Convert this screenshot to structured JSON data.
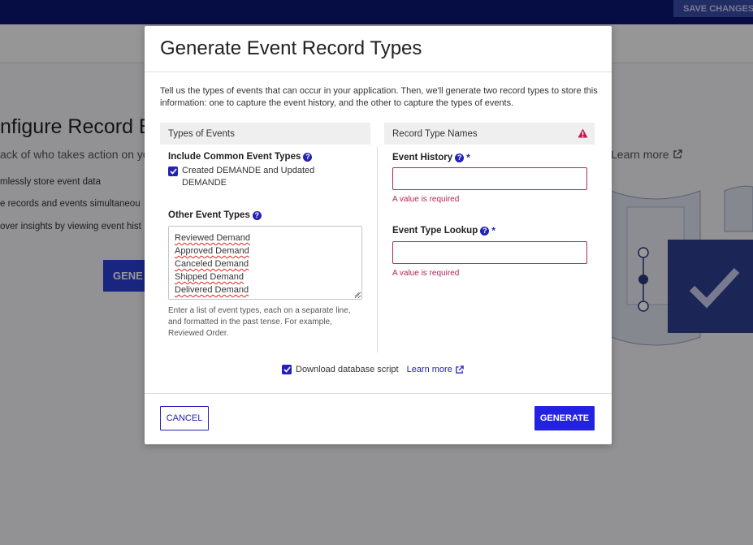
{
  "app": {
    "save_label": "SAVE CHANGES"
  },
  "background": {
    "title": "nfigure Record E",
    "subtitle": "ack of who takes action on yo",
    "bullets": [
      "mlessly store event data",
      "e records and events simultaneou",
      "over insights by viewing event hist"
    ],
    "generate_label": "GENE",
    "learn_more": "Learn more"
  },
  "modal": {
    "title": "Generate Event Record Types",
    "intro": "Tell us the types of events that can occur in your application. Then, we'll generate two record types to store this information: one to capture the event history, and the other to capture the types of events.",
    "left": {
      "header": "Types of Events",
      "common_label": "Include Common Event Types",
      "common_checkbox_label": "Created DEMANDE and Updated DEMANDE",
      "other_label": "Other Event Types",
      "other_events": [
        "Reviewed Demand",
        "Approved Demand",
        "Canceled Demand",
        "Shipped Demand",
        "Delivered Demand"
      ],
      "hint": "Enter a list of event types, each on a separate line, and formatted in the past tense. For example, Reviewed Order."
    },
    "right": {
      "header": "Record Type Names",
      "event_history_label": "Event History",
      "event_history_value": "",
      "event_history_error": "A value is required",
      "event_type_label": "Event Type Lookup",
      "event_type_value": "",
      "event_type_error": "A value is required",
      "required_mark": "*"
    },
    "download_label": "Download database script",
    "learn_more": "Learn more",
    "cancel_label": "CANCEL",
    "generate_label": "GENERATE"
  },
  "colors": {
    "accent": "#2322b5",
    "error": "#b3265a",
    "topbar": "#0b1572"
  }
}
